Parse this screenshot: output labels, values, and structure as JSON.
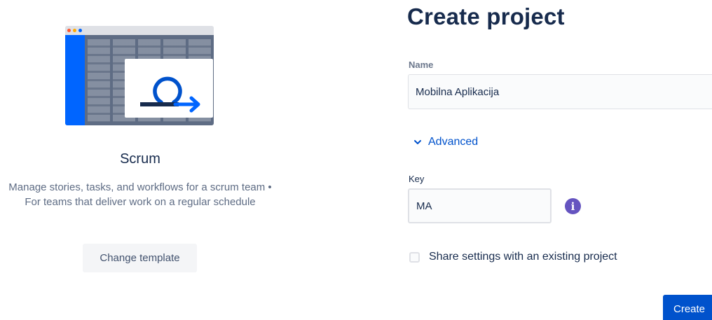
{
  "template": {
    "title": "Scrum",
    "description": "Manage stories, tasks, and workflows for a scrum team • For teams that deliver work on a regular schedule",
    "change_button_label": "Change template",
    "illustration_icon": "scrum-loop-icon"
  },
  "form": {
    "title": "Create project",
    "name_label": "Name",
    "name_value": "Mobilna Aplikacija",
    "advanced_label": "Advanced",
    "key_label": "Key",
    "key_value": "MA",
    "share_label": "Share settings with an existing project",
    "share_checked": false,
    "create_label": "Create"
  },
  "colors": {
    "primary": "#0052CC",
    "info": "#6554C0",
    "illustration_blue": "#0065FF",
    "text": "#172B4D",
    "subtle_text": "#5E6C84"
  }
}
